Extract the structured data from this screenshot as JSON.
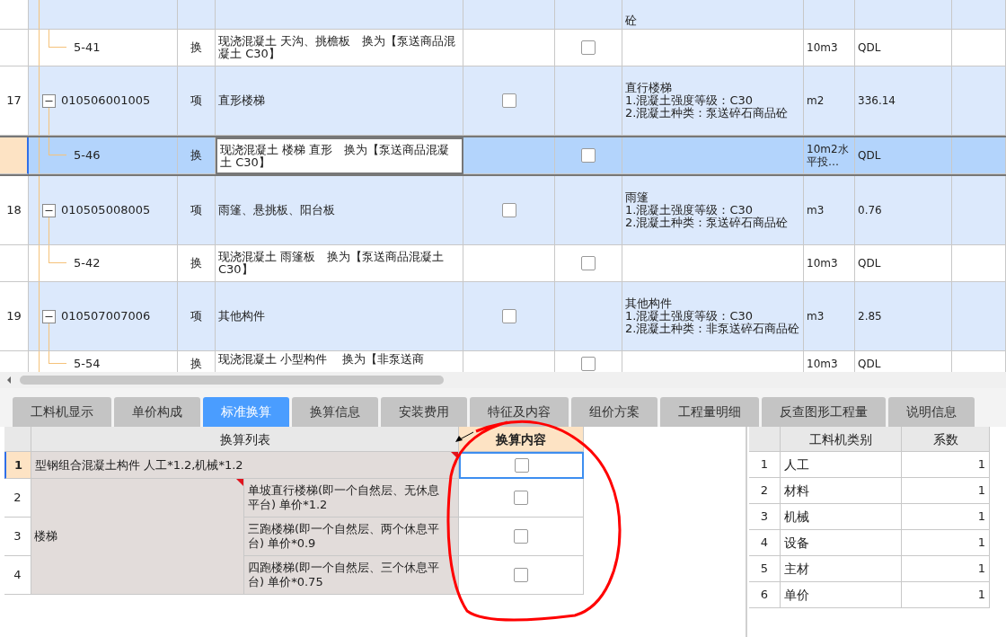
{
  "grid": {
    "rows": [
      {
        "kind": "partial",
        "features": "砼"
      },
      {
        "kind": "sub",
        "code": "5-41",
        "type": "换",
        "name": "现浇混凝土 天沟、挑檐板　换为【泵送商品混凝土 C30】",
        "unit": "10m3",
        "qty": "QDL",
        "checked": false,
        "selected": false
      },
      {
        "kind": "item",
        "num": "17",
        "code": "010506001005",
        "type": "项",
        "name": "直形楼梯",
        "features": "直行楼梯\n1.混凝土强度等级：C30\n2.混凝土种类：泵送碎石商品砼",
        "unit": "m2",
        "qty": "336.14",
        "checked": false,
        "expanded": true,
        "selected": false
      },
      {
        "kind": "sub",
        "code": "5-46",
        "type": "换",
        "name": "现浇混凝土 楼梯 直形　换为【泵送商品混凝土 C30】",
        "unit": "10m2水平投…",
        "qty": "QDL",
        "checked": false,
        "selected": true
      },
      {
        "kind": "item",
        "num": "18",
        "code": "010505008005",
        "type": "项",
        "name": "雨篷、悬挑板、阳台板",
        "features": "雨篷\n1.混凝土强度等级：C30\n2.混凝土种类：泵送碎石商品砼",
        "unit": "m3",
        "qty": "0.76",
        "checked": false,
        "expanded": true,
        "selected": false
      },
      {
        "kind": "sub",
        "code": "5-42",
        "type": "换",
        "name": "现浇混凝土 雨篷板　换为【泵送商品混凝土 C30】",
        "unit": "10m3",
        "qty": "QDL",
        "checked": false,
        "selected": false
      },
      {
        "kind": "item",
        "num": "19",
        "code": "010507007006",
        "type": "项",
        "name": "其他构件",
        "features": "其他构件\n1.混凝土强度等级：C30\n2.混凝土种类：非泵送碎石商品砼",
        "unit": "m3",
        "qty": "2.85",
        "checked": false,
        "expanded": true,
        "selected": false
      },
      {
        "kind": "cut",
        "code": "5-54",
        "type": "换",
        "name": "现浇混凝土 小型构件　 换为【非泵送商",
        "unit": "10m3",
        "qty": "QDL",
        "checked": false,
        "selected": false
      }
    ]
  },
  "tabs": [
    {
      "label": "工料机显示",
      "selected": false
    },
    {
      "label": "单价构成",
      "selected": false
    },
    {
      "label": "标准换算",
      "selected": true
    },
    {
      "label": "换算信息",
      "selected": false
    },
    {
      "label": "安装费用",
      "selected": false
    },
    {
      "label": "特征及内容",
      "selected": false
    },
    {
      "label": "组价方案",
      "selected": false
    },
    {
      "label": "工程量明细",
      "selected": false
    },
    {
      "label": "反查图形工程量",
      "selected": false
    },
    {
      "label": "说明信息",
      "selected": false
    }
  ],
  "conversion": {
    "columns": [
      "换算列表",
      "换算内容"
    ],
    "rows": [
      {
        "kind": "single",
        "num": "1",
        "text": "型钢组合混凝土构件 人工*1.2,机械*1.2",
        "comment": true,
        "checked": false,
        "selected": true
      },
      {
        "kind": "group",
        "label": "楼梯",
        "comment": true,
        "children": [
          {
            "num": "2",
            "text": "单坡直行楼梯(即一个自然层、无休息平台) 单价*1.2",
            "checked": false,
            "selected": false
          },
          {
            "num": "3",
            "text": "三跑楼梯(即一个自然层、两个休息平台) 单价*0.9",
            "checked": false,
            "selected": false
          },
          {
            "num": "4",
            "text": "四跑楼梯(即一个自然层、三个休息平台) 单价*0.75",
            "checked": false,
            "selected": false
          }
        ]
      }
    ]
  },
  "coefficients": {
    "columns": [
      "工料机类别",
      "系数"
    ],
    "rows": [
      {
        "num": "1",
        "category": "人工",
        "value": "1"
      },
      {
        "num": "2",
        "category": "材料",
        "value": "1"
      },
      {
        "num": "3",
        "category": "机械",
        "value": "1"
      },
      {
        "num": "4",
        "category": "设备",
        "value": "1"
      },
      {
        "num": "5",
        "category": "主材",
        "value": "1"
      },
      {
        "num": "6",
        "category": "单价",
        "value": "1"
      }
    ]
  }
}
